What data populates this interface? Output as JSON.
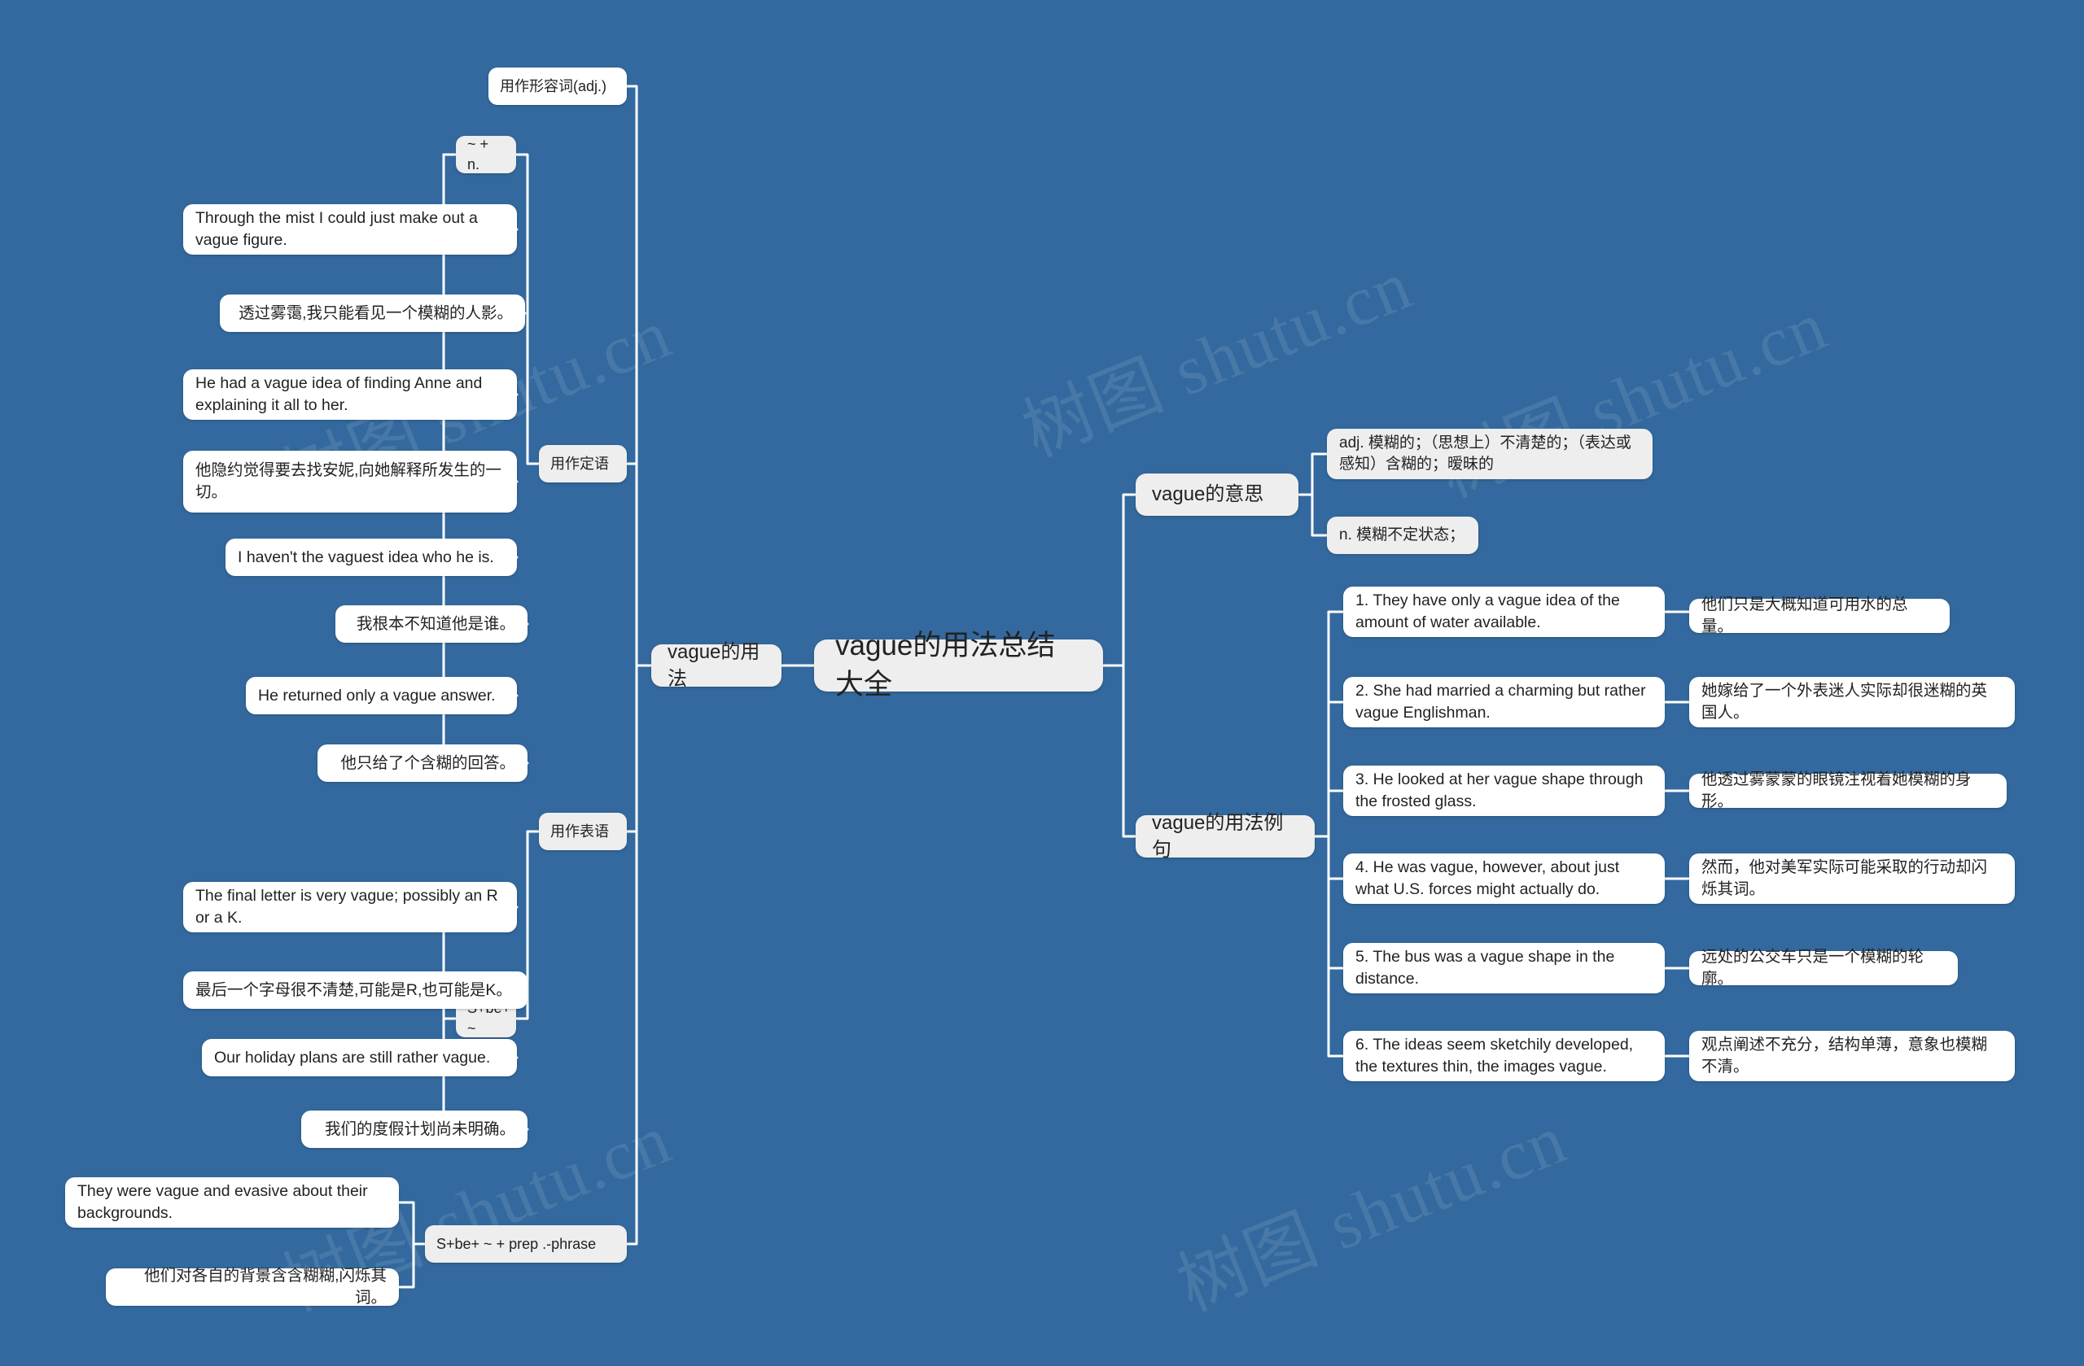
{
  "meta": {
    "background_color": "#33699e",
    "node_color": "#ffffff",
    "node_color_alt": "#eeeeee",
    "connector_color": "#ffffff",
    "text_color": "#222222"
  },
  "watermarks": [
    "树图 shutu.cn",
    "树图 shutu.cn",
    "树图 shutu.cn",
    "树图 shutu.cn",
    "树图 shutu.cn"
  ],
  "root": {
    "label": "vague的用法总结大全"
  },
  "branches": {
    "left": {
      "label": "vague的用法",
      "groups": [
        {
          "label": "用作形容词(adj.)",
          "subgroups": [
            {
              "label": "~ + n.",
              "parent_chip": "用作定语",
              "examples": [
                {
                  "en": "Through the mist I could just make out a vague figure.",
                  "zh": "透过雾霭,我只能看见一个模糊的人影。"
                },
                {
                  "en": "He had a vague idea of finding Anne and explaining it all to her.",
                  "zh": "他隐约觉得要去找安妮,向她解释所发生的一切。"
                },
                {
                  "en": "I haven't the vaguest idea who he is.",
                  "zh": "我根本不知道他是谁。"
                },
                {
                  "en": "He returned only a vague answer.",
                  "zh": "他只给了个含糊的回答。"
                }
              ]
            },
            {
              "label": "S+be+ ~",
              "parent_chip": "用作表语",
              "examples": [
                {
                  "en": "The final letter is very vague; possibly an R or a K.",
                  "zh": "最后一个字母很不清楚,可能是R,也可能是K。"
                },
                {
                  "en": "Our holiday plans are still rather vague.",
                  "zh": "我们的度假计划尚未明确。"
                }
              ]
            },
            {
              "label": "S+be+ ~ + prep .-phrase",
              "parent_chip": "",
              "examples": [
                {
                  "en": "They were vague and evasive about their backgrounds.",
                  "zh": "他们对各自的背景含含糊糊,闪烁其词。"
                }
              ]
            }
          ]
        }
      ],
      "chips": {
        "attributive": "用作定语",
        "predicative": "用作表语"
      }
    },
    "right": {
      "meaning": {
        "label": "vague的意思",
        "definitions": [
          "adj. 模糊的；（思想上）不清楚的；（表达或感知）含糊的；暧昧的",
          "n. 模糊不定状态；"
        ]
      },
      "examples": {
        "label": "vague的用法例句",
        "items": [
          {
            "en": "1. They have only a vague idea of the amount of water available.",
            "zh": "他们只是大概知道可用水的总量。"
          },
          {
            "en": "2. She had married a charming but rather vague Englishman.",
            "zh": "她嫁给了一个外表迷人实际却很迷糊的英国人。"
          },
          {
            "en": "3. He looked at her vague shape through the frosted glass.",
            "zh": "他透过雾蒙蒙的眼镜注视着她模糊的身形。"
          },
          {
            "en": "4. He was vague, however, about just what U.S. forces might actually do.",
            "zh": "然而，他对美军实际可能采取的行动却闪烁其词。"
          },
          {
            "en": "5. The bus was a vague shape in the distance.",
            "zh": "远处的公交车只是一个模糊的轮廓。"
          },
          {
            "en": "6. The ideas seem sketchily developed, the textures thin, the images vague.",
            "zh": "观点阐述不充分，结构单薄，意象也模糊不清。"
          }
        ]
      }
    }
  }
}
